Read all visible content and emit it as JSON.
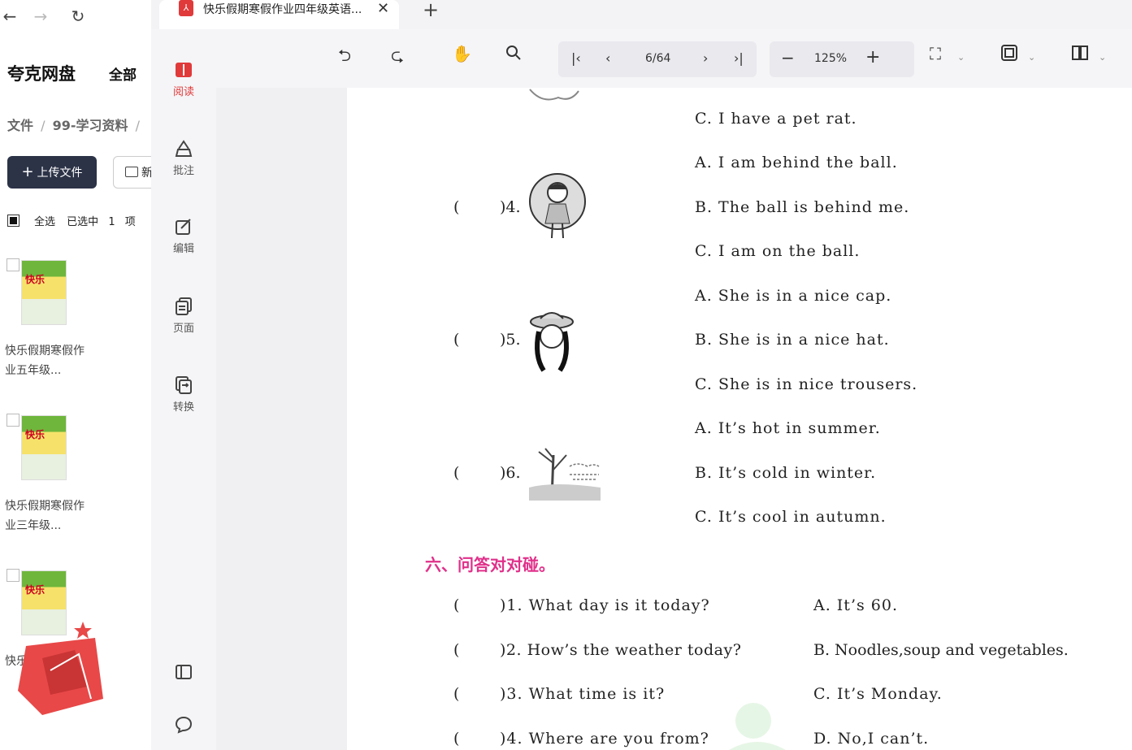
{
  "drive": {
    "title": "夸克网盘",
    "all_label": "全部",
    "breadcrumb_root": "文件",
    "breadcrumb_sep": "/",
    "breadcrumb_folder": "99-学习资料",
    "breadcrumb_sep2": "/",
    "upload_label": "上传文件",
    "new_label": "新",
    "select_all": "全选",
    "selected_label": "已选中",
    "selected_count": "1",
    "selected_unit": "项",
    "files": [
      {
        "name": "快乐假期寒假作业五年级...",
        "thumb": "快乐"
      },
      {
        "name": "快乐假期寒假作业三年级...",
        "thumb": "快乐"
      },
      {
        "name": "快乐...",
        "thumb": "快乐"
      }
    ]
  },
  "tabs": [
    {
      "title": "快乐假期寒假作业四年级英语..."
    }
  ],
  "rail": {
    "items": [
      {
        "label": "阅读",
        "icon": "book-icon",
        "active": true
      },
      {
        "label": "批注",
        "icon": "annotate-icon",
        "active": false
      },
      {
        "label": "编辑",
        "icon": "edit-icon",
        "active": false
      },
      {
        "label": "页面",
        "icon": "pages-icon",
        "active": false
      },
      {
        "label": "转换",
        "icon": "convert-icon",
        "active": false
      }
    ]
  },
  "toolbar": {
    "page_indicator": "6/64",
    "zoom": "125%"
  },
  "doc": {
    "options_top": [
      "C. I have a pet rat.",
      "A. I am behind the ball.",
      "B. The ball is behind me.",
      "C. I am on the ball.",
      "A. She is in a nice cap.",
      "B. She is in a nice hat.",
      "C. She is in nice trousers.",
      "A. It’s hot in summer.",
      "B. It’s cold in winter.",
      "C. It’s cool in autumn."
    ],
    "pic_questions": [
      {
        "paren": "(",
        "num": ")4."
      },
      {
        "paren": "(",
        "num": ")5."
      },
      {
        "paren": "(",
        "num": ")6."
      }
    ],
    "section_title": "六、问答对对碰。",
    "qa": [
      {
        "paren": "(",
        "question": ")1. What day is it today?",
        "answer": "A. It’s 60."
      },
      {
        "paren": "(",
        "question": ")2. How’s the weather today?",
        "answer": "B. Noodles,soup and vegetables."
      },
      {
        "paren": "(",
        "question": ")3. What time is it?",
        "answer": "C. It’s Monday."
      },
      {
        "paren": "(",
        "question": ")4. Where are you from?",
        "answer": "D. No,I can’t."
      }
    ]
  },
  "colors": {
    "accent": "#e03a3a",
    "section": "#e0308a",
    "upload_bg": "#2c3347"
  }
}
